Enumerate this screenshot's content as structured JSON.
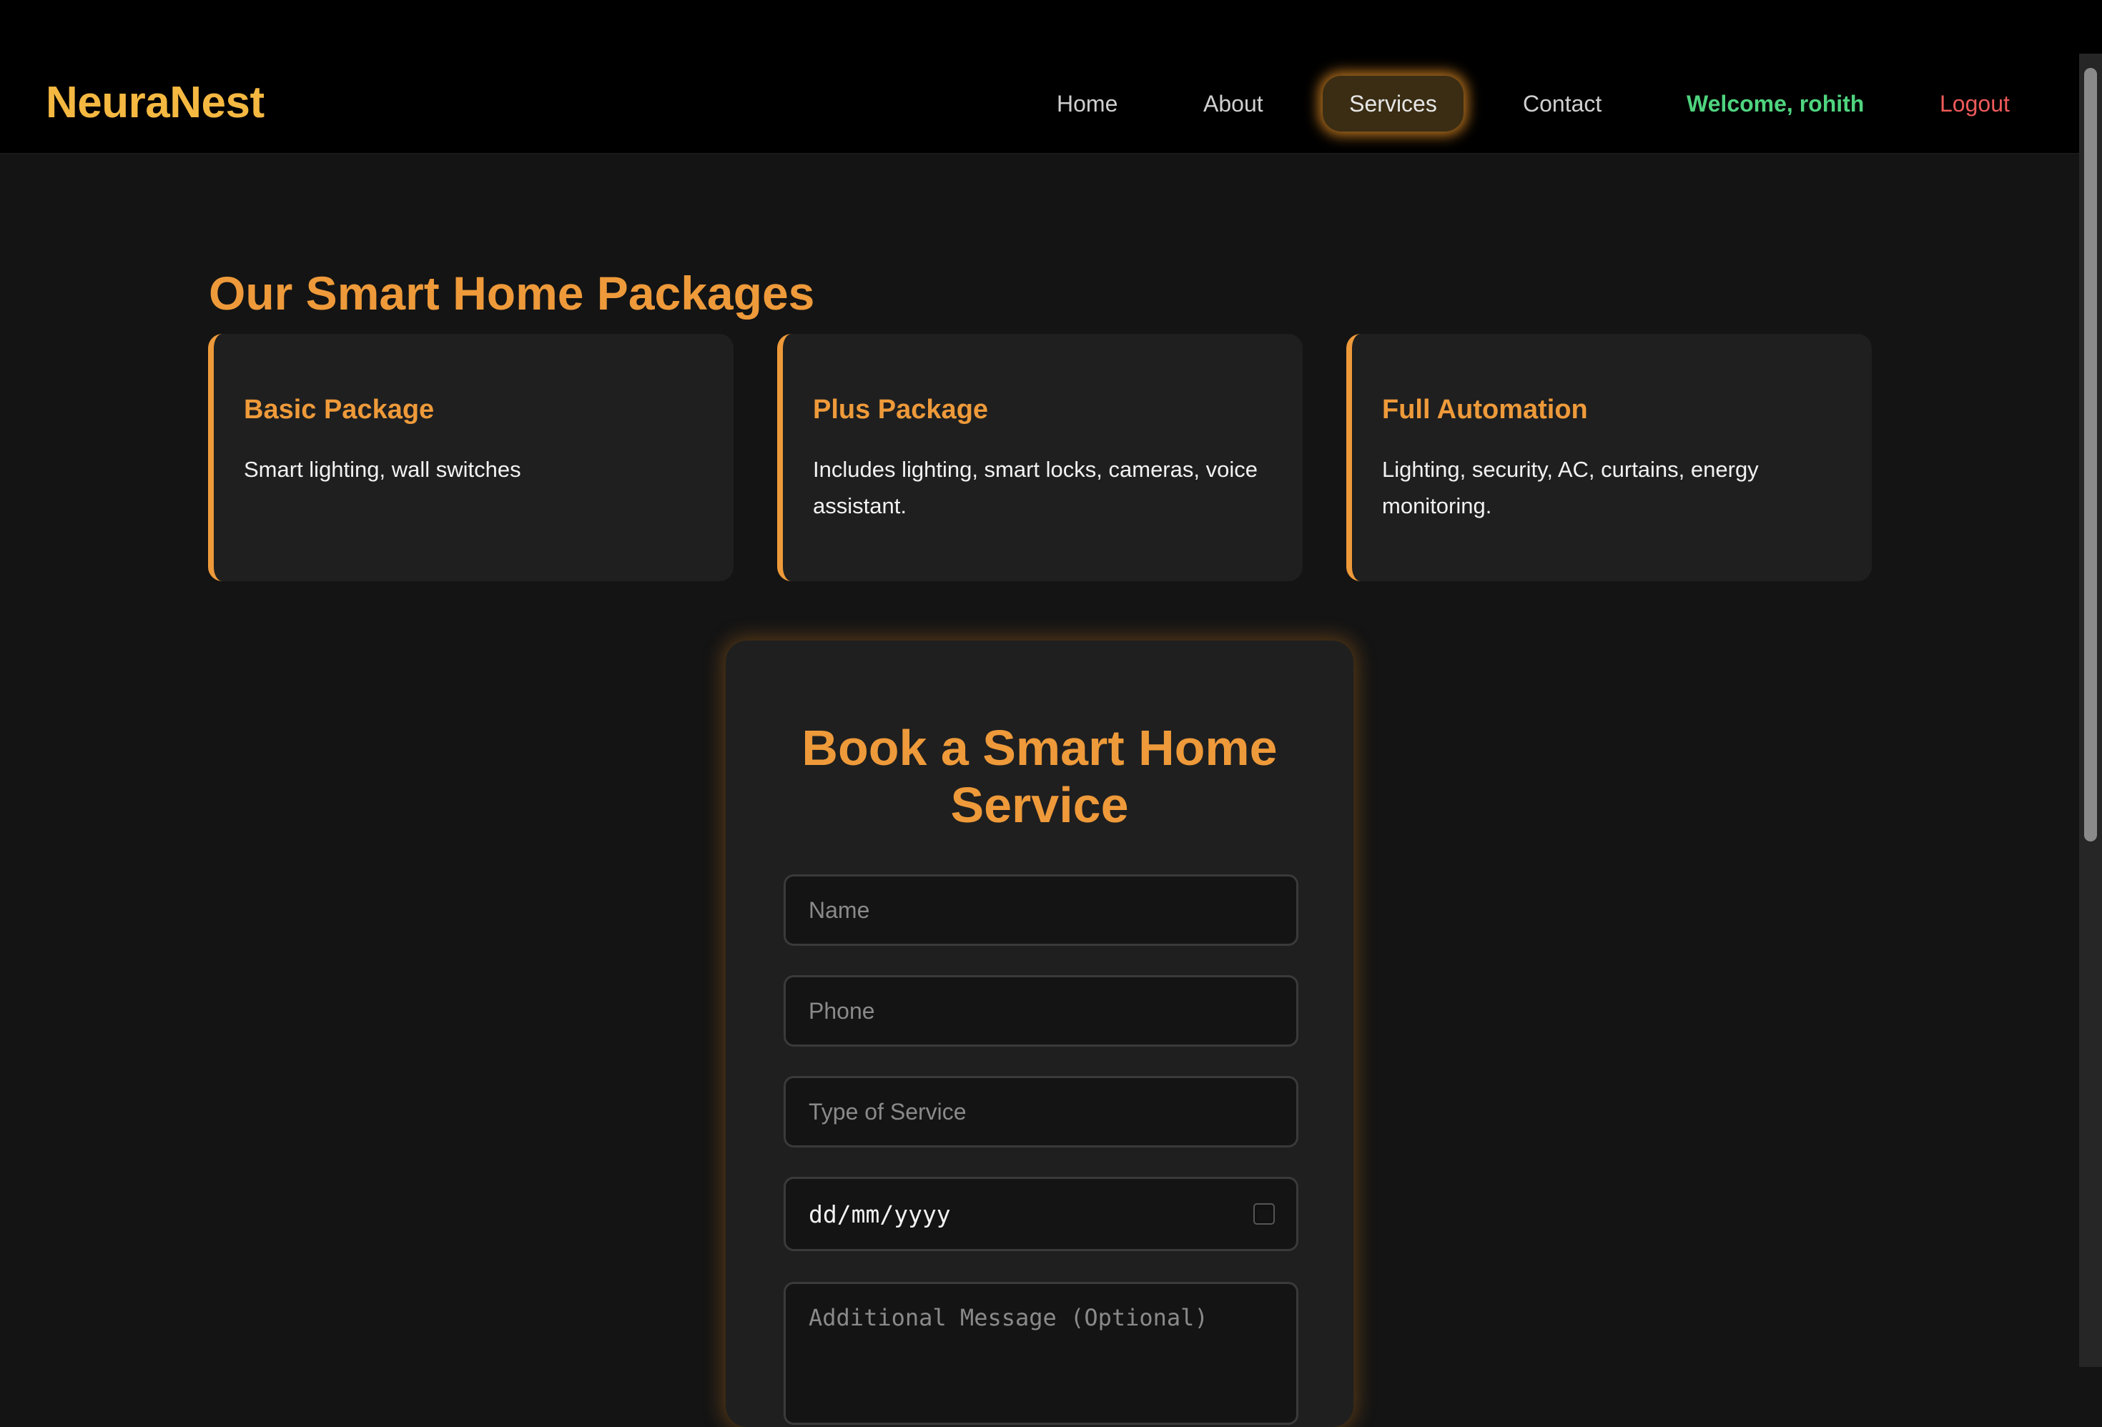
{
  "brand": {
    "name": "NeuraNest"
  },
  "nav": {
    "home": "Home",
    "about": "About",
    "services": "Services",
    "contact": "Contact",
    "welcome": "Welcome, rohith",
    "logout": "Logout"
  },
  "packages": {
    "title": "Our Smart Home Packages",
    "items": [
      {
        "name": "Basic Package",
        "description": "Smart lighting, wall switches"
      },
      {
        "name": "Plus Package",
        "description": "Includes lighting, smart locks, cameras, voice assistant."
      },
      {
        "name": "Full Automation",
        "description": "Lighting, security, AC, curtains, energy monitoring."
      }
    ]
  },
  "booking": {
    "title": "Book a Smart Home Service",
    "fields": {
      "name_placeholder": "Name",
      "phone_placeholder": "Phone",
      "service_placeholder": "Type of Service",
      "date_placeholder": "dd/mm/yyyy",
      "message_placeholder": "Additional Message (Optional)"
    }
  },
  "icons": {
    "date": "calendar-icon"
  },
  "colors": {
    "accent": "#ee9a3a",
    "logo": "#f5b841",
    "welcome": "#4fd47f",
    "logout": "#ef5a5a",
    "background": "#141414",
    "card": "#1f1f1f"
  }
}
